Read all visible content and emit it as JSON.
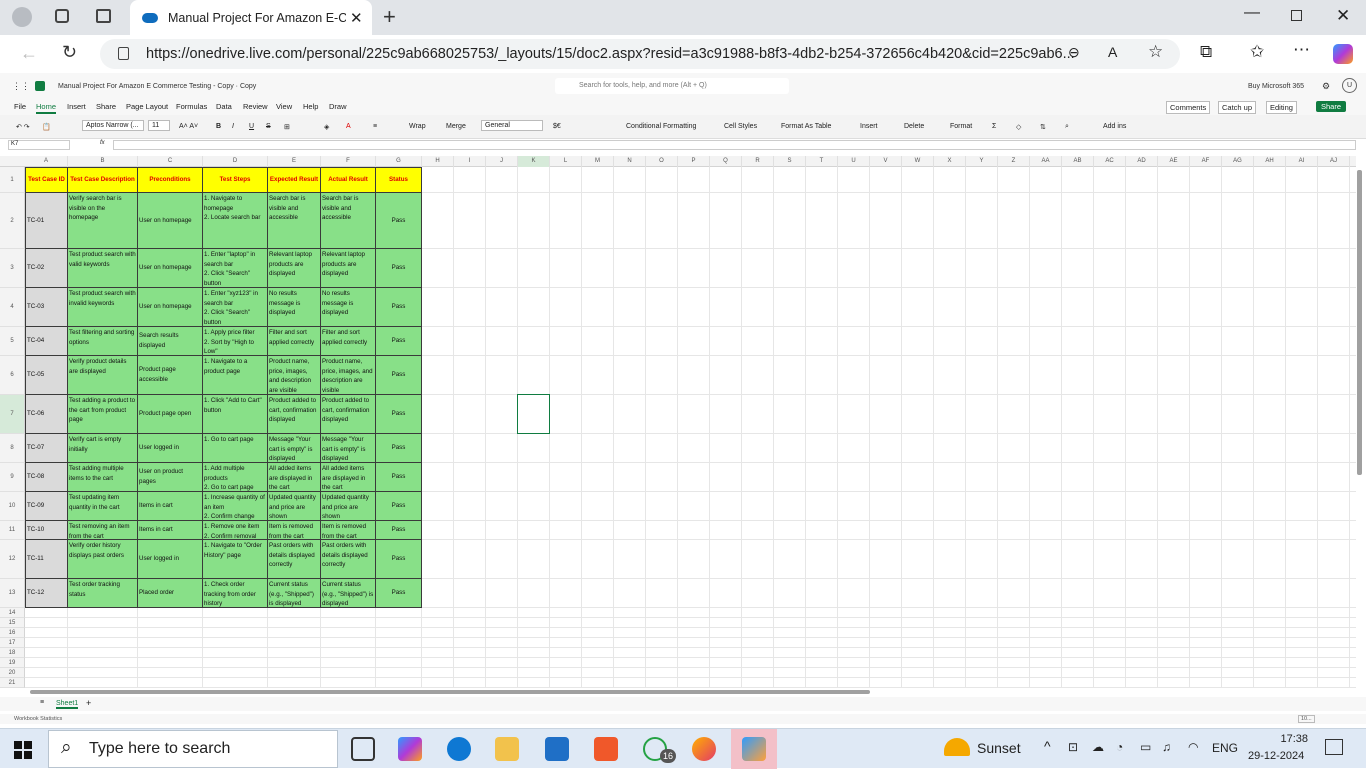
{
  "browser": {
    "tab_title": "Manual Project For Amazon E-Commerce Testing",
    "url": "https://onedrive.live.com/personal/225c9ab668025753/_layouts/15/doc2.aspx?resid=a3c91988-b8f3-4db2-b254-372656c4b420&cid=225c9ab6..."
  },
  "app": {
    "doc_title": "Manual Project For Amazon E Commerce Testing - Copy · Copy",
    "search_placeholder": "Search for tools, help, and more (Alt + Q)",
    "buy_label": "Buy Microsoft 365",
    "avatar": "U"
  },
  "menu": {
    "items": [
      "File",
      "Home",
      "Insert",
      "Share",
      "Page Layout",
      "Formulas",
      "Data",
      "Review",
      "View",
      "Help",
      "Draw"
    ],
    "comments": "Comments",
    "catchup": "Catch up",
    "editing": "Editing",
    "share": "Share"
  },
  "ribbon": {
    "font": "Aptos Narrow (...",
    "size": "11",
    "wrap": "Wrap",
    "merge": "Merge",
    "number_format": "General",
    "cond_fmt": "Conditional Formatting",
    "cell_styles": "Cell Styles",
    "format_table": "Format As Table",
    "insert": "Insert",
    "delete": "Delete",
    "format": "Format",
    "addins": "Add ins"
  },
  "formula": {
    "name_box": "K7",
    "fx": "fx"
  },
  "columns": [
    "A",
    "B",
    "C",
    "D",
    "E",
    "F",
    "G",
    "H",
    "I",
    "J",
    "K",
    "L",
    "M",
    "N",
    "O",
    "P",
    "Q",
    "R",
    "S",
    "T",
    "U",
    "V",
    "W",
    "X",
    "Y",
    "Z",
    "AA",
    "AB",
    "AC",
    "AD",
    "AE",
    "AF",
    "AG",
    "AH",
    "AI",
    "AJ"
  ],
  "rows": [
    "1",
    "2",
    "3",
    "4",
    "5",
    "6",
    "7",
    "8",
    "9",
    "10",
    "11",
    "12",
    "13",
    "14",
    "15",
    "16",
    "17",
    "18",
    "19",
    "20",
    "21"
  ],
  "table": {
    "headers": [
      "Test Case ID",
      "Test Case Description",
      "Preconditions",
      "Test Steps",
      "Expected Result",
      "Actual Result",
      "Status"
    ],
    "data": [
      [
        "TC-01",
        "Verify search bar is visible on the homepage",
        "User on homepage",
        "1. Navigate to homepage\n2. Locate search bar",
        "Search bar is visible and accessible",
        "Search bar is visible and accessible",
        "Pass"
      ],
      [
        "TC-02",
        "Test product search with valid keywords",
        "User on homepage",
        "1. Enter \"laptop\" in search bar\n2. Click \"Search\" button",
        "Relevant laptop products are displayed",
        "Relevant laptop products are displayed",
        "Pass"
      ],
      [
        "TC-03",
        "Test product search with invalid keywords",
        "User on homepage",
        "1. Enter \"xyz123\" in search bar\n2. Click \"Search\" button",
        "No results message is displayed",
        "No results message is displayed",
        "Pass"
      ],
      [
        "TC-04",
        "Test filtering and sorting options",
        "Search results displayed",
        "1. Apply price filter\n2. Sort by \"High to Low\"",
        "Filter and sort applied correctly",
        "Filter and sort applied correctly",
        "Pass"
      ],
      [
        "TC-05",
        "Verify product details are displayed",
        "Product page accessible",
        "1. Navigate to a product page",
        "Product name, price, images, and description are visible",
        "Product name, price, images, and description are visible",
        "Pass"
      ],
      [
        "TC-06",
        "Test adding a product to the cart from product page",
        "Product page open",
        "1. Click \"Add to Cart\" button",
        "Product added to cart, confirmation displayed",
        "Product added to cart, confirmation displayed",
        "Pass"
      ],
      [
        "TC-07",
        "Verify cart is empty initially",
        "User logged in",
        "1. Go to cart page",
        "Message \"Your cart is empty\" is displayed",
        "Message \"Your cart is empty\" is displayed",
        "Pass"
      ],
      [
        "TC-08",
        "Test adding multiple items to the cart",
        "User on product pages",
        "1. Add multiple products\n2. Go to cart page",
        "All added items are displayed in the cart",
        "All added items are displayed in the cart",
        "Pass"
      ],
      [
        "TC-09",
        "Test updating item quantity in the cart",
        "Items in cart",
        "1. Increase quantity of an item\n2. Confirm change",
        "Updated quantity and price are shown",
        "Updated quantity and price are shown",
        "Pass"
      ],
      [
        "TC-10",
        "Test removing an item from the cart",
        "Items in cart",
        "1. Remove one item\n2. Confirm removal",
        "Item is removed from the cart",
        "Item is removed from the cart",
        "Pass"
      ],
      [
        "TC-11",
        "Verify order history displays past orders",
        "User logged in",
        "1. Navigate to \"Order History\" page",
        "Past orders with details displayed correctly",
        "Past orders with details displayed correctly",
        "Pass"
      ],
      [
        "TC-12",
        "Test order tracking status",
        "Placed order",
        "1. Check order tracking from order history",
        "Current status (e.g., \"Shipped\") is displayed",
        "Current status (e.g., \"Shipped\") is displayed",
        "Pass"
      ]
    ]
  },
  "sheet": {
    "tab": "Sheet1",
    "status": "Workbook Statistics",
    "zoom": "10..."
  },
  "taskbar": {
    "search_placeholder": "Type here to search",
    "weather": "Sunset",
    "lang": "ENG",
    "time": "17:38",
    "date": "29-12-2024",
    "whatsapp_badge": "16"
  }
}
